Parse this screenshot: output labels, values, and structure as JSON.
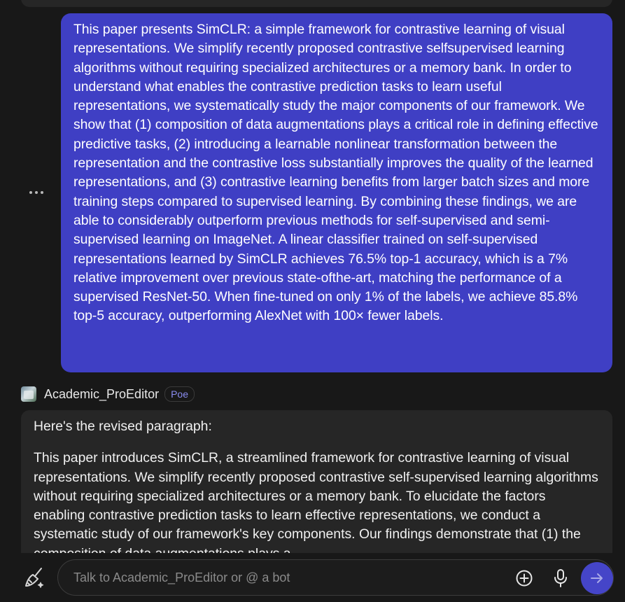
{
  "user_message": {
    "text": "This paper presents SimCLR: a simple framework for contrastive learning of visual representations. We simplify recently proposed contrastive selfsupervised learning algorithms without requiring specialized architectures or a memory bank. In order to understand what enables the contrastive prediction tasks to learn useful representations, we systematically study the major components of our framework. We show that (1) composition of data augmentations plays a critical role in defining effective predictive tasks, (2) introducing a learnable nonlinear transformation between the representation and the contrastive loss substantially improves the quality of the learned representations, and (3) contrastive learning benefits from larger batch sizes and more training steps compared to supervised learning. By combining these findings, we are able to considerably outperform previous methods for self-supervised and semi-supervised learning on ImageNet. A linear classifier trained on self-supervised representations learned by SimCLR achieves 76.5% top-1 accuracy, which is a 7% relative improvement over previous state-ofthe-art, matching the performance of a supervised ResNet-50. When fine-tuned on only 1% of the labels, we achieve 85.8% top-5 accuracy, outperforming AlexNet with 100× fewer labels."
  },
  "bot": {
    "name": "Academic_ProEditor",
    "badge": "Poe",
    "avatar_icon": "bot-avatar-image"
  },
  "bot_message": {
    "intro": "Here's the revised paragraph:",
    "body": "This paper introduces SimCLR, a streamlined framework for contrastive learning of visual representations. We simplify recently proposed contrastive self-supervised learning algorithms without requiring specialized architectures or a memory bank. To elucidate the factors enabling contrastive prediction tasks to learn effective representations, we conduct a systematic study of our framework's key components. Our findings demonstrate that (1) the composition of data augmentations plays a"
  },
  "composer": {
    "placeholder": "Talk to Academic_ProEditor or @ a bot",
    "icons": [
      "broom-icon",
      "plus-circle-icon",
      "microphone-icon",
      "arrow-right-icon",
      "more-options-icon"
    ]
  },
  "colors": {
    "background": "#181818",
    "user_bubble": "#3f3fc4",
    "bot_bubble": "#262626",
    "accent": "#4545c8",
    "badge_text": "#8a8cf0"
  }
}
